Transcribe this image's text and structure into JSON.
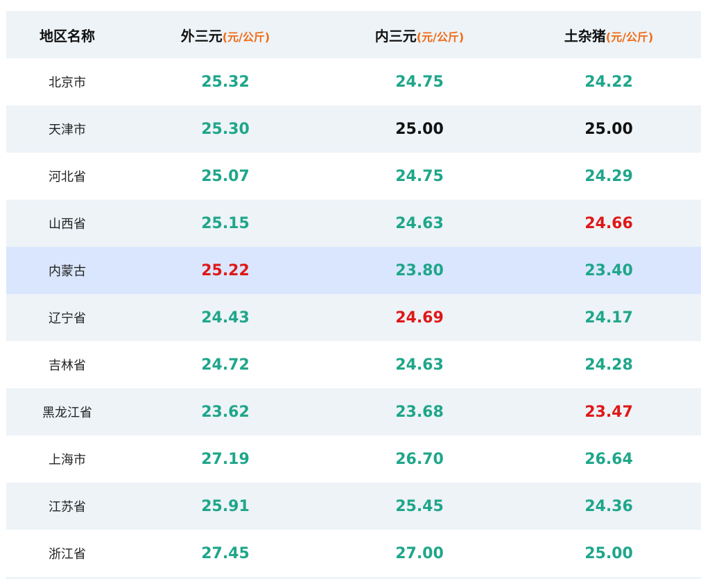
{
  "colors": {
    "header_bg": "#edf3f7",
    "alt_row_bg": "#edf3f7",
    "highlight_row_bg": "#d9e6fd",
    "value_green": "#1fa68a",
    "value_red": "#e01717",
    "value_black": "#111111",
    "unit_orange": "#f26a14"
  },
  "table": {
    "headers": [
      {
        "label": "地区名称",
        "unit": ""
      },
      {
        "label": "外三元",
        "unit": "(元/公斤)"
      },
      {
        "label": "内三元",
        "unit": "(元/公斤)"
      },
      {
        "label": "土杂猪",
        "unit": "(元/公斤)"
      }
    ],
    "rows": [
      {
        "region": "北京市",
        "bg": "white",
        "values": [
          "25.32",
          "24.75",
          "24.22"
        ],
        "colors": [
          "green",
          "green",
          "green"
        ]
      },
      {
        "region": "天津市",
        "bg": "alt",
        "values": [
          "25.30",
          "25.00",
          "25.00"
        ],
        "colors": [
          "green",
          "black",
          "black"
        ]
      },
      {
        "region": "河北省",
        "bg": "white",
        "values": [
          "25.07",
          "24.75",
          "24.29"
        ],
        "colors": [
          "green",
          "green",
          "green"
        ]
      },
      {
        "region": "山西省",
        "bg": "alt",
        "values": [
          "25.15",
          "24.63",
          "24.66"
        ],
        "colors": [
          "green",
          "green",
          "red"
        ]
      },
      {
        "region": "内蒙古",
        "bg": "hl",
        "values": [
          "25.22",
          "23.80",
          "23.40"
        ],
        "colors": [
          "red",
          "green",
          "green"
        ]
      },
      {
        "region": "辽宁省",
        "bg": "alt",
        "values": [
          "24.43",
          "24.69",
          "24.17"
        ],
        "colors": [
          "green",
          "red",
          "green"
        ]
      },
      {
        "region": "吉林省",
        "bg": "white",
        "values": [
          "24.72",
          "24.63",
          "24.28"
        ],
        "colors": [
          "green",
          "green",
          "green"
        ]
      },
      {
        "region": "黑龙江省",
        "bg": "alt",
        "values": [
          "23.62",
          "23.68",
          "23.47"
        ],
        "colors": [
          "green",
          "green",
          "red"
        ]
      },
      {
        "region": "上海市",
        "bg": "white",
        "values": [
          "27.19",
          "26.70",
          "26.64"
        ],
        "colors": [
          "green",
          "green",
          "green"
        ]
      },
      {
        "region": "江苏省",
        "bg": "alt",
        "values": [
          "25.91",
          "25.45",
          "24.36"
        ],
        "colors": [
          "green",
          "green",
          "green"
        ]
      },
      {
        "region": "浙江省",
        "bg": "white",
        "values": [
          "27.45",
          "27.00",
          "25.00"
        ],
        "colors": [
          "green",
          "green",
          "green"
        ]
      }
    ]
  }
}
